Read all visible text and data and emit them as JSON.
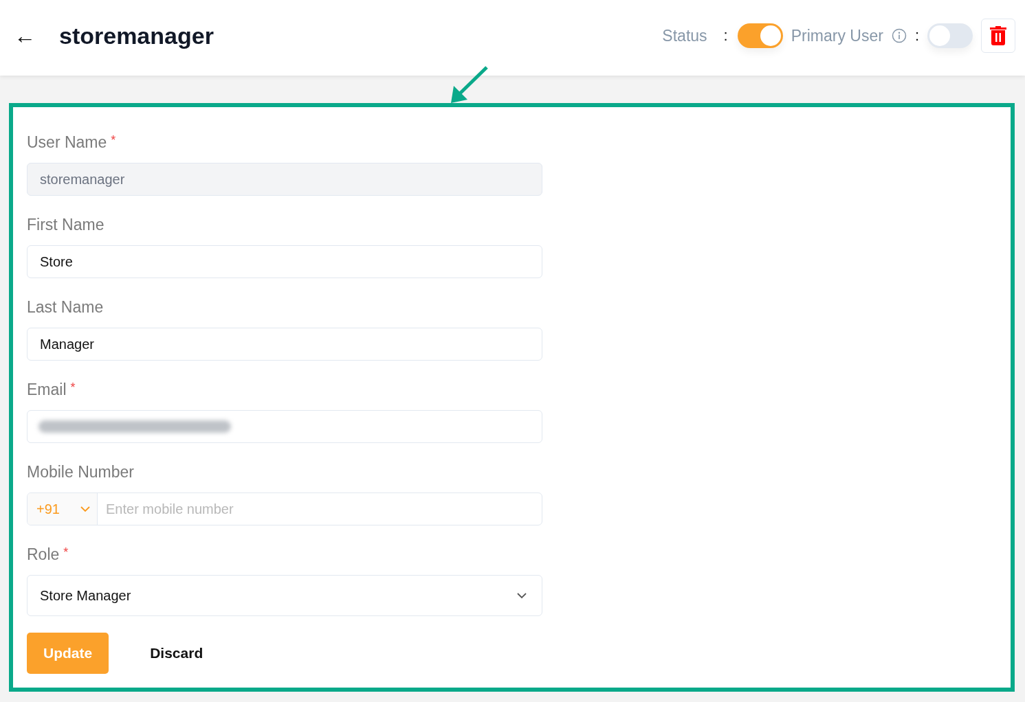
{
  "header": {
    "back_icon": "←",
    "title": "storemanager",
    "status": {
      "label": "Status",
      "separator": ":",
      "on": true
    },
    "primary_user": {
      "label": "Primary User",
      "separator": ":",
      "on": false
    }
  },
  "form": {
    "fields": [
      {
        "kind": "text",
        "label": "User Name",
        "required": true,
        "required_mark": "*",
        "value": "storemanager",
        "disabled": true
      },
      {
        "kind": "text",
        "label": "First Name",
        "value": "Store",
        "disabled": false
      },
      {
        "kind": "text",
        "label": "Last Name",
        "value": "Manager",
        "disabled": false
      },
      {
        "kind": "redacted",
        "label": "Email",
        "required": true,
        "required_mark": "*",
        "disabled": false
      },
      {
        "kind": "phone",
        "label": "Mobile Number",
        "code": "+91",
        "placeholder": "Enter mobile number",
        "disabled": false
      },
      {
        "kind": "select",
        "label": "Role",
        "required": true,
        "required_mark": "*",
        "value": "Store Manager",
        "disabled": false
      }
    ],
    "buttons": [
      {
        "kind": "primary",
        "label": "Update"
      },
      {
        "kind": "plain",
        "label": "Discard"
      }
    ]
  }
}
